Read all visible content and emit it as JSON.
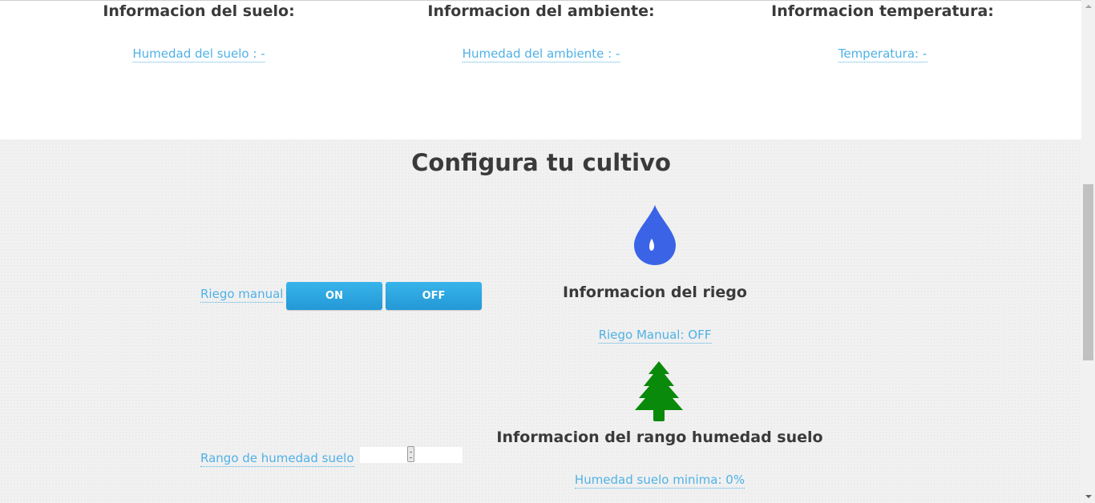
{
  "info": {
    "suelo": {
      "title": "Informacion del suelo:",
      "link": "Humedad del suelo : -"
    },
    "ambiente": {
      "title": "Informacion del ambiente:",
      "link": "Humedad del ambiente : -"
    },
    "temperatura": {
      "title": "Informacion temperatura:",
      "link": "Temperatura: -"
    }
  },
  "config": {
    "title": "Configura tu cultivo",
    "riego_label": "Riego manual",
    "on_label": "ON",
    "off_label": "OFF",
    "rango_label": "Rango de humedad suelo",
    "range_value_fraction": 0.5
  },
  "riego_panel": {
    "icon": "water-drop-icon",
    "title": "Informacion del riego",
    "status": "Riego Manual: OFF"
  },
  "rango_panel": {
    "icon": "tree-icon",
    "title": "Informacion del rango humedad suelo",
    "status": "Humedad suelo minima: 0%"
  },
  "colors": {
    "accent_link": "#4fb1e6",
    "button": "#2aa7e3",
    "drop": "#3b63e6",
    "tree": "#0a8a0a",
    "heading": "#3a3a3a"
  }
}
